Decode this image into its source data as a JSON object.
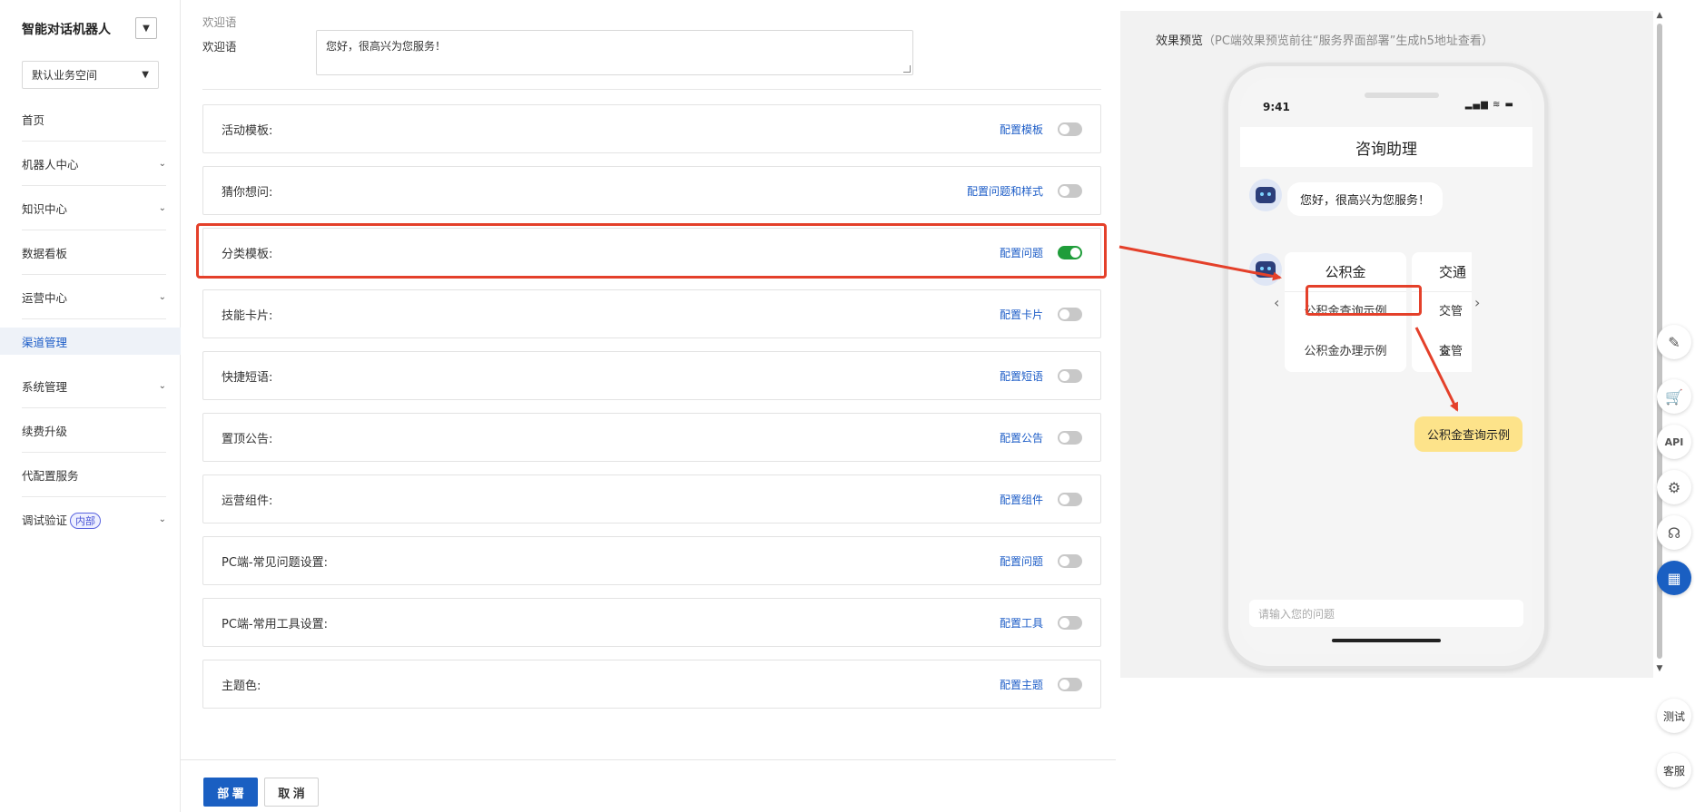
{
  "sidebar": {
    "brand": "智能对话机器人",
    "workspace": "默认业务空间",
    "items": [
      {
        "label": "首页",
        "has_children": false
      },
      {
        "label": "机器人中心",
        "has_children": true
      },
      {
        "label": "知识中心",
        "has_children": true
      },
      {
        "label": "数据看板",
        "has_children": false
      },
      {
        "label": "运营中心",
        "has_children": true
      },
      {
        "label": "渠道管理",
        "has_children": false,
        "active": true
      },
      {
        "label": "系统管理",
        "has_children": true
      },
      {
        "label": "续费升级",
        "has_children": false
      },
      {
        "label": "代配置服务",
        "has_children": false
      },
      {
        "label": "调试验证",
        "badge": "内部",
        "has_children": true
      }
    ]
  },
  "welcome": {
    "section_title": "欢迎语",
    "label": "欢迎语",
    "value": "您好，很高兴为您服务！"
  },
  "rows": [
    {
      "label": "活动模板:",
      "link": "配置模板",
      "enabled": false
    },
    {
      "label": "猜你想问:",
      "link": "配置问题和样式",
      "enabled": false
    },
    {
      "label": "分类模板:",
      "link": "配置问题",
      "enabled": true
    },
    {
      "label": "技能卡片:",
      "link": "配置卡片",
      "enabled": false
    },
    {
      "label": "快捷短语:",
      "link": "配置短语",
      "enabled": false
    },
    {
      "label": "置顶公告:",
      "link": "配置公告",
      "enabled": false
    },
    {
      "label": "运营组件:",
      "link": "配置组件",
      "enabled": false
    },
    {
      "label": "PC端-常见问题设置:",
      "link": "配置问题",
      "enabled": false
    },
    {
      "label": "PC端-常用工具设置:",
      "link": "配置工具",
      "enabled": false
    },
    {
      "label": "主题色:",
      "link": "配置主题",
      "enabled": false
    }
  ],
  "footer": {
    "deploy": "部 署",
    "cancel": "取 消"
  },
  "preview": {
    "title": "效果预览",
    "hint": "（PC端效果预览前往“服务界面部署”生成h5地址查看）",
    "phone": {
      "time": "9:41",
      "status_icons": "▂▄▆ ≋ ▬",
      "header": "咨询助理",
      "greeting": "您好，很高兴为您服务！",
      "card1": {
        "title": "公积金",
        "items": [
          "公积金查询示例",
          "公积金办理示例"
        ]
      },
      "card2": {
        "title": "交通",
        "items": [
          "交管查",
          "交管办"
        ]
      },
      "selected_question": "公积金查询示例",
      "input_placeholder": "请输入您的问题"
    }
  },
  "rail": {
    "icons": [
      "edit-icon",
      "cart-icon",
      "api-icon",
      "gear-icon",
      "headset-icon",
      "apps-icon"
    ],
    "test_label": "测试",
    "service_label": "客服"
  },
  "colors": {
    "accent": "#1a5fc2",
    "toggle_on": "#1f9d3a",
    "annotation": "#e4402a",
    "answer_bubble": "#fde38a"
  }
}
